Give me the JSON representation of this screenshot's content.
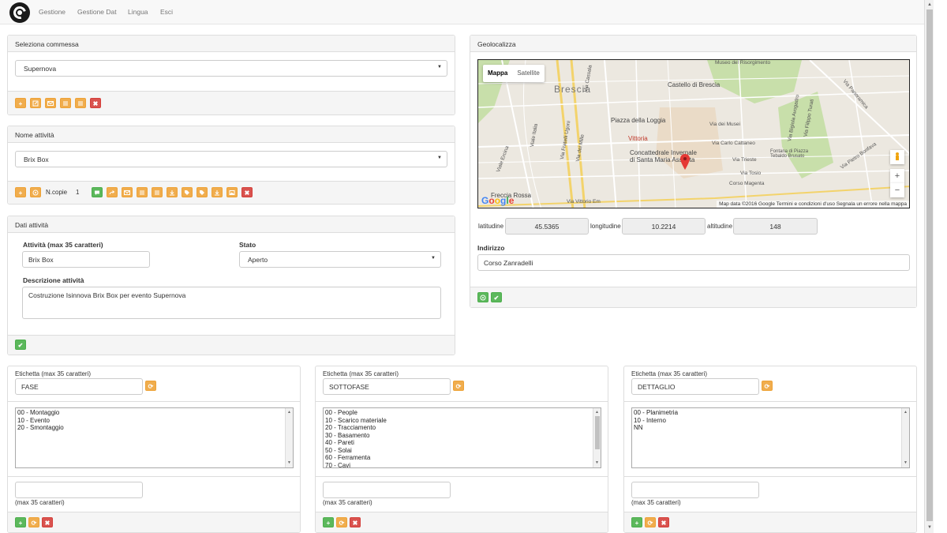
{
  "nav": {
    "items": [
      "Gestione",
      "Gestione Dat",
      "Lingua",
      "Esci"
    ]
  },
  "commessa": {
    "title": "Seleziona commessa",
    "selected": "Supernova",
    "toolbar_icons": [
      "add-icon",
      "edit-icon",
      "mail-icon",
      "list-icon",
      "list-icon",
      "delete-icon"
    ]
  },
  "attivita": {
    "title": "Nome attività",
    "selected": "Brix Box",
    "copies_label": "N.copie",
    "copies_value": "1"
  },
  "dati": {
    "title": "Dati attività",
    "activity_label": "Attività (max 35 caratteri)",
    "activity_value": "Brix Box",
    "status_label": "Stato",
    "status_value": "Aperto",
    "description_label": "Descrizione attività",
    "description_value": "Costruzione Isinnova Brix Box per evento Supernova"
  },
  "geo": {
    "title": "Geolocalizza",
    "map_type": [
      "Mappa",
      "Satellite"
    ],
    "map_labels": {
      "city": "Brescia",
      "castello": "Castello di Brescia",
      "piazza": "Piazza della Loggia",
      "cattedrale_1": "Concattedrale Invernale",
      "cattedrale_2": "di Santa Maria Assunta",
      "freccia": "Freccia Rossa",
      "vittoria": "Vittoria",
      "museo": "Museo del Risorgimento",
      "via_cassala": "Via Cassala",
      "via_italia": "Viale Italia",
      "via_fratelli": "Via Fratelli Ugoni",
      "via_mille": "Via dei Mille",
      "via_musei": "Via dei Musei",
      "via_trieste": "Via Trieste",
      "corso_magenta": "Corso Magenta",
      "via_tosio": "Via Tosio",
      "via_carlo": "Via Carlo Cattaneo",
      "via_venezia": "Via Vittorio Em",
      "via_panoramica": "Via Panoramica",
      "via_bonfava": "Via Pietro Bonfava",
      "via_bixio": "Via Bigiola Avogadro",
      "fontana": "Fontana di Piazza Tebaldo Brusato",
      "via_filippo": "Via Filippo Turati",
      "via_ercina": "Viale Ercina"
    },
    "map_footer": "Map data ©2016 Google    Termini e condizioni d'uso    Segnala un errore nella mappa",
    "google": "Google",
    "zoom_in": "+",
    "zoom_out": "−",
    "lat_label": "latitudine",
    "lat_value": "45.5365",
    "lng_label": "longitudine",
    "lng_value": "10.2214",
    "alt_label": "altitudine",
    "alt_value": "148",
    "address_label": "Indirizzo",
    "address_value": "Corso Zanradelli"
  },
  "columns": [
    {
      "label": "Etichetta (max 35 caratteri)",
      "value": "FASE",
      "items": [
        "00 - Montaggio",
        "10 - Evento",
        "20 - Smontaggio"
      ],
      "hint": "(max 35 caratteri)"
    },
    {
      "label": "Etichetta (max 35 caratteri)",
      "value": "SOTTOFASE",
      "items": [
        "00 - People",
        "10 - Scarico materiale",
        "20 - Tracciamento",
        "30 - Basamento",
        "40 - Pareti",
        "50 - Solai",
        "60 - Ferramenta",
        "70 - Cavi"
      ],
      "hint": "(max 35 caratteri)"
    },
    {
      "label": "Etichetta (max 35 caratteri)",
      "value": "DETTAGLIO",
      "items": [
        "00 - Planimetria",
        "10 - Interno",
        "NN"
      ],
      "hint": "(max 35 caratteri)"
    }
  ]
}
